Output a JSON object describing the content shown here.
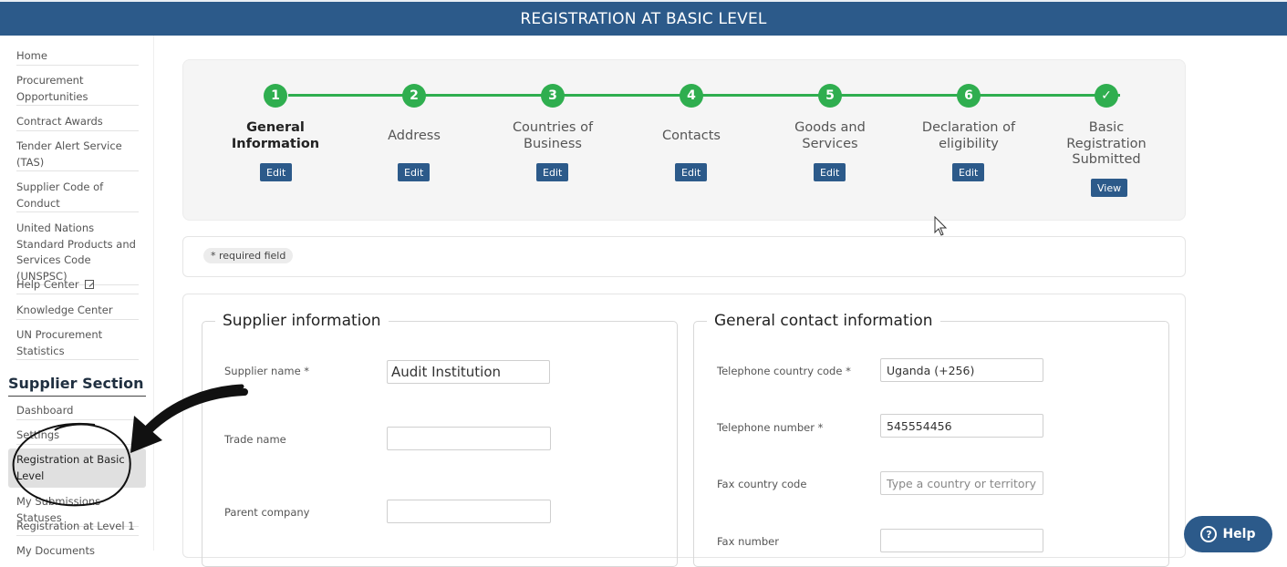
{
  "header": {
    "title": "REGISTRATION AT BASIC LEVEL"
  },
  "sidebar": {
    "items": [
      {
        "label": "Home"
      },
      {
        "label": "Procurement Opportunities"
      },
      {
        "label": "Contract Awards"
      },
      {
        "label": "Tender Alert Service (TAS)"
      },
      {
        "label": "Supplier Code of Conduct"
      },
      {
        "label": "United Nations Standard Products and Services Code (UNSPSC)"
      },
      {
        "label": "Help Center"
      },
      {
        "label": "Knowledge Center"
      },
      {
        "label": "UN Procurement Statistics"
      }
    ],
    "section_title": "Supplier Section",
    "supplier_items": [
      {
        "label": "Dashboard"
      },
      {
        "label": "Settings"
      },
      {
        "label": "Registration at Basic Level"
      },
      {
        "label": "My Submissions Statuses"
      },
      {
        "label": "Registration at Level 1"
      },
      {
        "label": "My Documents"
      }
    ]
  },
  "steps": [
    {
      "num": "1",
      "label": "General Information",
      "button": "Edit"
    },
    {
      "num": "2",
      "label": "Address",
      "button": "Edit"
    },
    {
      "num": "3",
      "label": "Countries of Business",
      "button": "Edit"
    },
    {
      "num": "4",
      "label": "Contacts",
      "button": "Edit"
    },
    {
      "num": "5",
      "label": "Goods and Services",
      "button": "Edit"
    },
    {
      "num": "6",
      "label": "Declaration of eligibility",
      "button": "Edit"
    },
    {
      "num": "✓",
      "label": "Basic Registration Submitted",
      "button": "View"
    }
  ],
  "required_note": "* required field",
  "supplier_info": {
    "legend": "Supplier information",
    "supplier_name_label": "Supplier name *",
    "supplier_name_value": "Audit Institution",
    "trade_name_label": "Trade name",
    "trade_name_value": "",
    "parent_company_label": "Parent company",
    "parent_company_value": ""
  },
  "contact_info": {
    "legend": "General contact information",
    "tel_country_label": "Telephone country code *",
    "tel_country_value": "Uganda (+256)",
    "tel_number_label": "Telephone number *",
    "tel_number_value": "545554456",
    "fax_country_label": "Fax country code",
    "fax_country_placeholder": "Type a country or territory name",
    "fax_number_label": "Fax number",
    "fax_number_value": ""
  },
  "help_button": {
    "label": "Help"
  },
  "colors": {
    "brand": "#2c5a8a",
    "step_complete": "#2fae4f"
  }
}
